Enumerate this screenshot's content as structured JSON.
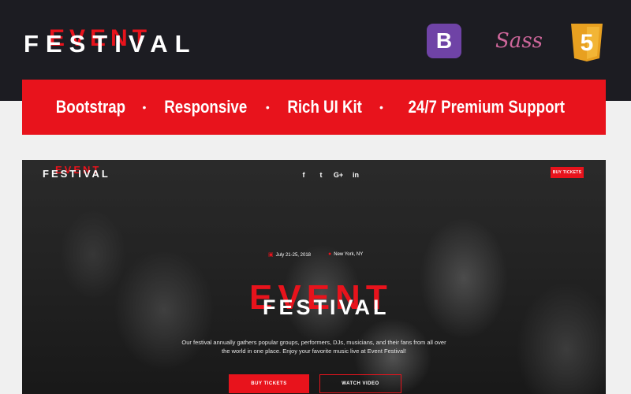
{
  "logo": {
    "event": "EVENT",
    "festival": "FESTIVAL"
  },
  "tech_icons": [
    {
      "name": "bootstrap-icon",
      "glyph": "B",
      "color": "#6f43a6"
    },
    {
      "name": "sass-icon",
      "glyph": "Sass",
      "color": "#cd669a"
    },
    {
      "name": "html5-icon",
      "glyph": "5",
      "color": "#e8a020"
    }
  ],
  "features": {
    "item1": "Bootstrap",
    "item2": "Responsive",
    "item3": "Rich UI Kit",
    "item4": "24/7 Premium Support",
    "separator": "•"
  },
  "hero": {
    "logo_event": "EVENT",
    "logo_festival": "FESTIVAL",
    "social": {
      "facebook": "f",
      "twitter": "t",
      "google": "G+",
      "linkedin": "in"
    },
    "buy_top_label": "BUY TICKETS",
    "date": "July 21-25, 2018",
    "location": "New York, NY",
    "title_event": "EVENT",
    "title_festival": "FESTIVAL",
    "description": "Our festival annually gathers popular groups, performers, DJs, musicians, and their fans from all over the world in one place. Enjoy your favorite music live at Event Festival!",
    "buy_label": "BUY TICKETS",
    "watch_label": "WATCH VIDEO"
  },
  "colors": {
    "accent": "#e8131c",
    "dark": "#1c1c22",
    "white": "#ffffff"
  }
}
